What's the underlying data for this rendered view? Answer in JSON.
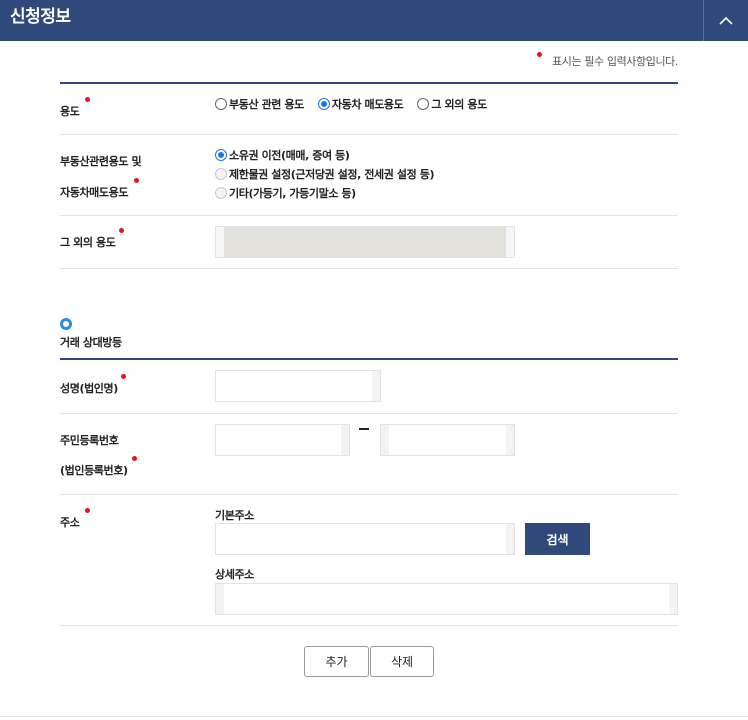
{
  "header": {
    "title": "신청정보",
    "collapse_icon": "chevron-up-icon"
  },
  "required_note": "표시는 필수 입력사항입니다.",
  "usage": {
    "label": "용도",
    "options": [
      {
        "label": "부동산 관련 용도",
        "checked": false
      },
      {
        "label": "자동차 매도용도",
        "checked": true
      },
      {
        "label": "그 외의 용도",
        "checked": false
      }
    ]
  },
  "realestate_usage": {
    "label_line1": "부동산관련용도 및",
    "label_line2": "자동차매도용도",
    "options": [
      {
        "label": "소유권 이전(매매, 증여 등)",
        "checked": true,
        "enabled": true
      },
      {
        "label": "제한물권 설정(근저당권 설정, 전세권 설정 등)",
        "checked": false,
        "enabled": false
      },
      {
        "label": "기타(가등기, 가등기말소 등)",
        "checked": false,
        "enabled": false
      }
    ]
  },
  "other_usage": {
    "label": "그 외의 용도",
    "value": ""
  },
  "counterparty": {
    "section_title": "거래 상대방등",
    "name_label": "성명(법인명)",
    "name_value": "",
    "rrn_label_line1": "주민등록번호",
    "rrn_label_line2": "(법인등록번호)",
    "rrn_first": "",
    "rrn_separator": "-",
    "rrn_second": "",
    "address_label": "주소",
    "basic_address_label": "기본주소",
    "basic_address_value": "",
    "search_button": "검색",
    "detail_address_label": "상세주소",
    "detail_address_value": ""
  },
  "actions": {
    "add_label": "추가",
    "delete_label": "삭제"
  },
  "colors": {
    "header_bg": "#2f4a7a",
    "required_dot": "#e5141c",
    "radio_checked": "#1a73e8",
    "section_circle": "#2b8fe0"
  }
}
